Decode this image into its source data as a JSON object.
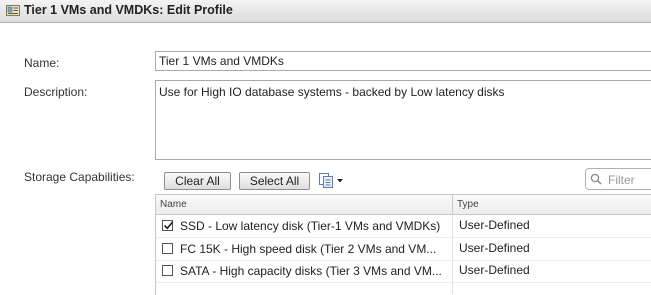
{
  "window": {
    "title": "Tier 1 VMs and VMDKs: Edit Profile",
    "icon": "profile-icon"
  },
  "form": {
    "name_label": "Name:",
    "name_value": "Tier 1 VMs and VMDKs",
    "description_label": "Description:",
    "description_value": "Use for High IO database systems - backed by Low latency disks",
    "storage_label": "Storage Capabilities:"
  },
  "toolbar": {
    "clear_all": "Clear All",
    "select_all": "Select All",
    "copy_icon": "copy-icon",
    "filter_placeholder": "Filter"
  },
  "grid": {
    "columns": [
      "Name",
      "Type"
    ],
    "rows": [
      {
        "checked": true,
        "name": "SSD - Low latency disk (Tier-1 VMs and VMDKs)",
        "type": "User-Defined"
      },
      {
        "checked": false,
        "name": "FC 15K - High speed disk (Tier 2 VMs and VM...",
        "type": "User-Defined"
      },
      {
        "checked": false,
        "name": "SATA - High capacity disks (Tier 3 VMs and VM...",
        "type": "User-Defined"
      }
    ]
  }
}
